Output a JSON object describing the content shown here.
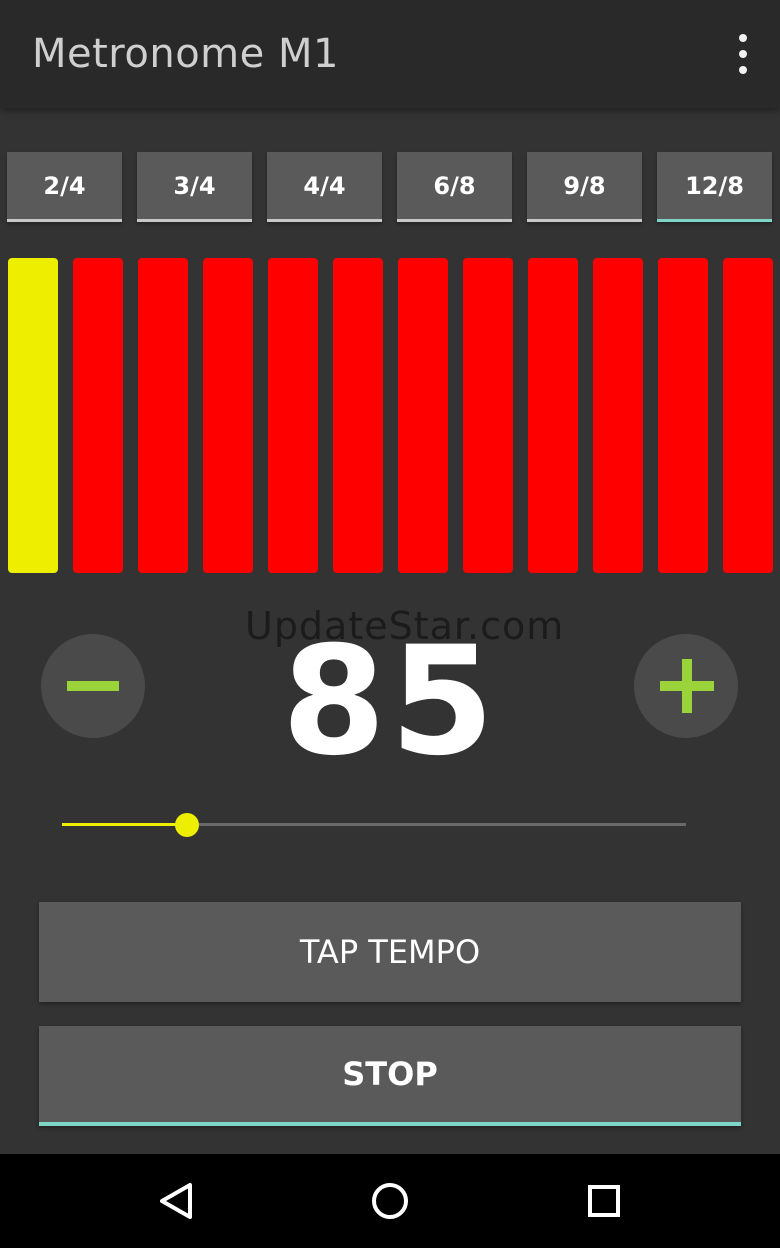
{
  "app": {
    "title": "Metronome M1",
    "menu_icon": "more-vert-icon"
  },
  "time_signatures": {
    "items": [
      {
        "label": "2/4",
        "active": false
      },
      {
        "label": "3/4",
        "active": false
      },
      {
        "label": "4/4",
        "active": false
      },
      {
        "label": "6/8",
        "active": false
      },
      {
        "label": "9/8",
        "active": false
      },
      {
        "label": "12/8",
        "active": true
      }
    ]
  },
  "beats": {
    "count": 12,
    "current_beat": 1,
    "active_color": "#eeee00",
    "inactive_color": "#ff0000"
  },
  "watermark": "UpdateStar.com",
  "tempo": {
    "value": "85",
    "decrease_icon": "minus-icon",
    "increase_icon": "plus-icon",
    "accent_color": "#9bd43a"
  },
  "slider": {
    "fraction": 0.2,
    "color": "#eeee00"
  },
  "buttons": {
    "tap_tempo": "TAP TEMPO",
    "stop": "STOP",
    "accent_color": "#7fd6c6"
  },
  "system_nav": {
    "back_icon": "back-triangle-icon",
    "home_icon": "home-circle-icon",
    "recents_icon": "recents-square-icon"
  }
}
